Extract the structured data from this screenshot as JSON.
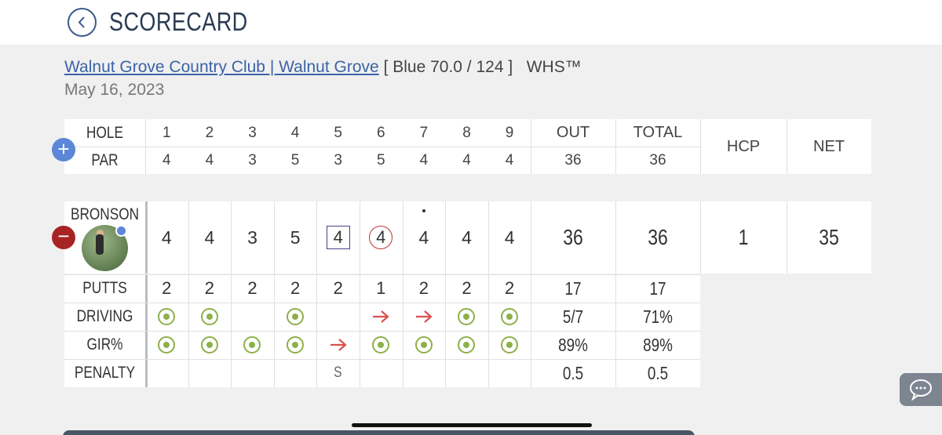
{
  "header": {
    "title": "SCORECARD",
    "back_icon": "chevron-left-icon"
  },
  "course": {
    "link_text": "Walnut Grove Country Club | Walnut Grove",
    "tees": "[ Blue 70.0 / 124 ]",
    "system": "WHS™",
    "date": "May 16, 2023"
  },
  "holes_header": {
    "hole_label": "HOLE",
    "par_label": "PAR",
    "holes": [
      "1",
      "2",
      "3",
      "4",
      "5",
      "6",
      "7",
      "8",
      "9"
    ],
    "pars": [
      "4",
      "4",
      "3",
      "5",
      "3",
      "5",
      "4",
      "4",
      "4"
    ],
    "out_label": "OUT",
    "out_par": "36",
    "total_label": "TOTAL",
    "total_par": "36",
    "hcp_label": "HCP",
    "net_label": "NET"
  },
  "player": {
    "name": "BRONSON",
    "scores": [
      "4",
      "4",
      "3",
      "5",
      "4",
      "4",
      "4",
      "4",
      "4"
    ],
    "out": "36",
    "total": "36",
    "hcp": "1",
    "net": "35"
  },
  "stats": {
    "putts_label": "PUTTS",
    "putts": [
      "2",
      "2",
      "2",
      "2",
      "2",
      "1",
      "2",
      "2",
      "2"
    ],
    "putts_out": "17",
    "putts_total": "17",
    "driving_label": "DRIVING",
    "driving": [
      "hit",
      "hit",
      "",
      "hit",
      "",
      "miss-right",
      "miss-right",
      "hit",
      "hit"
    ],
    "driving_out": "5/7",
    "driving_total": "71%",
    "gir_label": "GIR%",
    "gir": [
      "hit",
      "hit",
      "hit",
      "hit",
      "miss-right",
      "hit",
      "hit",
      "hit",
      "hit"
    ],
    "gir_out": "89%",
    "gir_total": "89%",
    "penalty_label": "PENALTY",
    "penalty": [
      "",
      "",
      "",
      "",
      "S",
      "",
      "",
      "",
      ""
    ],
    "penalty_out": "0.5",
    "penalty_total": "0.5"
  },
  "colors": {
    "accent": "#3b63a8",
    "hit": "#8db04a",
    "miss": "#d9534f",
    "minus": "#a82424",
    "plus": "#5b87d6"
  }
}
